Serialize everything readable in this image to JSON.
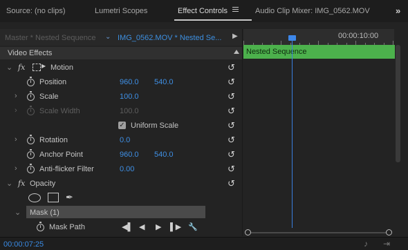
{
  "tabs": [
    {
      "label": "Source: (no clips)",
      "active": false
    },
    {
      "label": "Lumetri Scopes",
      "active": false
    },
    {
      "label": "Effect Controls",
      "active": true
    },
    {
      "label": "Audio Clip Mixer: IMG_0562.MOV",
      "active": false
    }
  ],
  "header": {
    "master_label": "Master * Nested Sequence",
    "clip_label": "IMG_0562.MOV * Nested Se..."
  },
  "section_title": "Video Effects",
  "effects": {
    "motion": "Motion",
    "position": {
      "label": "Position",
      "x": "960.0",
      "y": "540.0"
    },
    "scale": {
      "label": "Scale",
      "value": "100.0"
    },
    "scale_width": {
      "label": "Scale Width",
      "value": "100.0"
    },
    "uniform_scale": {
      "label": "Uniform Scale",
      "checked": true
    },
    "rotation": {
      "label": "Rotation",
      "value": "0.0"
    },
    "anchor_point": {
      "label": "Anchor Point",
      "x": "960.0",
      "y": "540.0"
    },
    "anti_flicker": {
      "label": "Anti-flicker Filter",
      "value": "0.00"
    },
    "opacity": "Opacity",
    "mask": "Mask (1)",
    "mask_path": "Mask Path"
  },
  "timeline": {
    "time_label": "00:00:10:00",
    "clip_name": "Nested Sequence",
    "clip_color": "#4cb14c"
  },
  "footer": {
    "timecode": "00:00:07:25"
  },
  "colors": {
    "accent": "#3f90e6",
    "background": "#232323"
  }
}
